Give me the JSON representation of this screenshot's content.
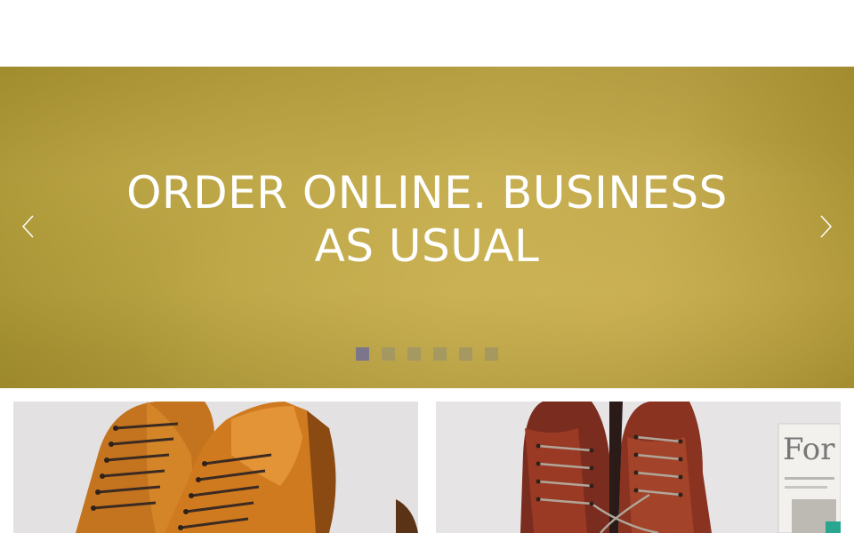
{
  "hero": {
    "headline": "ORDER ONLINE. BUSINESS AS USUAL",
    "prev_icon": "chevron-left-icon",
    "next_icon": "chevron-right-icon",
    "slide_count": 6,
    "active_slide": 1
  },
  "cards": [
    {
      "name": "tan-brogue-boots",
      "image": "tan leather brogue boots"
    },
    {
      "name": "burgundy-brogue-boots",
      "image": "burgundy leather brogue boots with magazine",
      "magazine_text": "For"
    }
  ],
  "colors": {
    "hero_gold": "#bda84a",
    "dot_active": "#7c768a",
    "dot_inactive": "#a0966a"
  }
}
